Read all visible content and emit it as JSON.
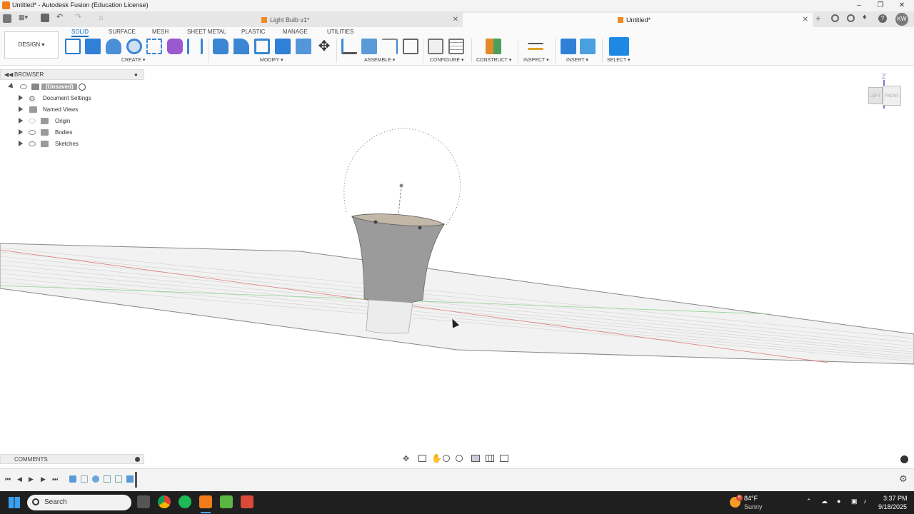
{
  "window": {
    "title": "Untitled* - Autodesk Fusion (Education License)"
  },
  "tabs": [
    {
      "label": "Light Bulb v1*",
      "active": false
    },
    {
      "label": "Untitled*",
      "active": true
    }
  ],
  "user_initials": "KW",
  "ribbon": {
    "workspace": "DESIGN",
    "tabs": [
      "SOLID",
      "SURFACE",
      "MESH",
      "SHEET METAL",
      "PLASTIC",
      "MANAGE",
      "UTILITIES"
    ],
    "groups": [
      "CREATE",
      "MODIFY",
      "ASSEMBLE",
      "CONFIGURE",
      "CONSTRUCT",
      "INSPECT",
      "INSERT",
      "SELECT"
    ]
  },
  "browser": {
    "title": "BROWSER",
    "root": "(Unsaved)",
    "items": [
      "Document Settings",
      "Named Views",
      "Origin",
      "Bodies",
      "Sketches"
    ]
  },
  "viewcube": {
    "top": "Z",
    "left": "LEFT",
    "front": "FRONT"
  },
  "comments": {
    "title": "COMMENTS"
  },
  "taskbar": {
    "search_placeholder": "Search",
    "weather_temp": "84°F",
    "weather_desc": "Sunny",
    "weather_badge": "6",
    "time": "3:37 PM",
    "date": "9/18/2025"
  },
  "colors": {
    "accent": "#0a6dc2",
    "brand": "#f07d1a",
    "selection": "#1e88e5"
  }
}
